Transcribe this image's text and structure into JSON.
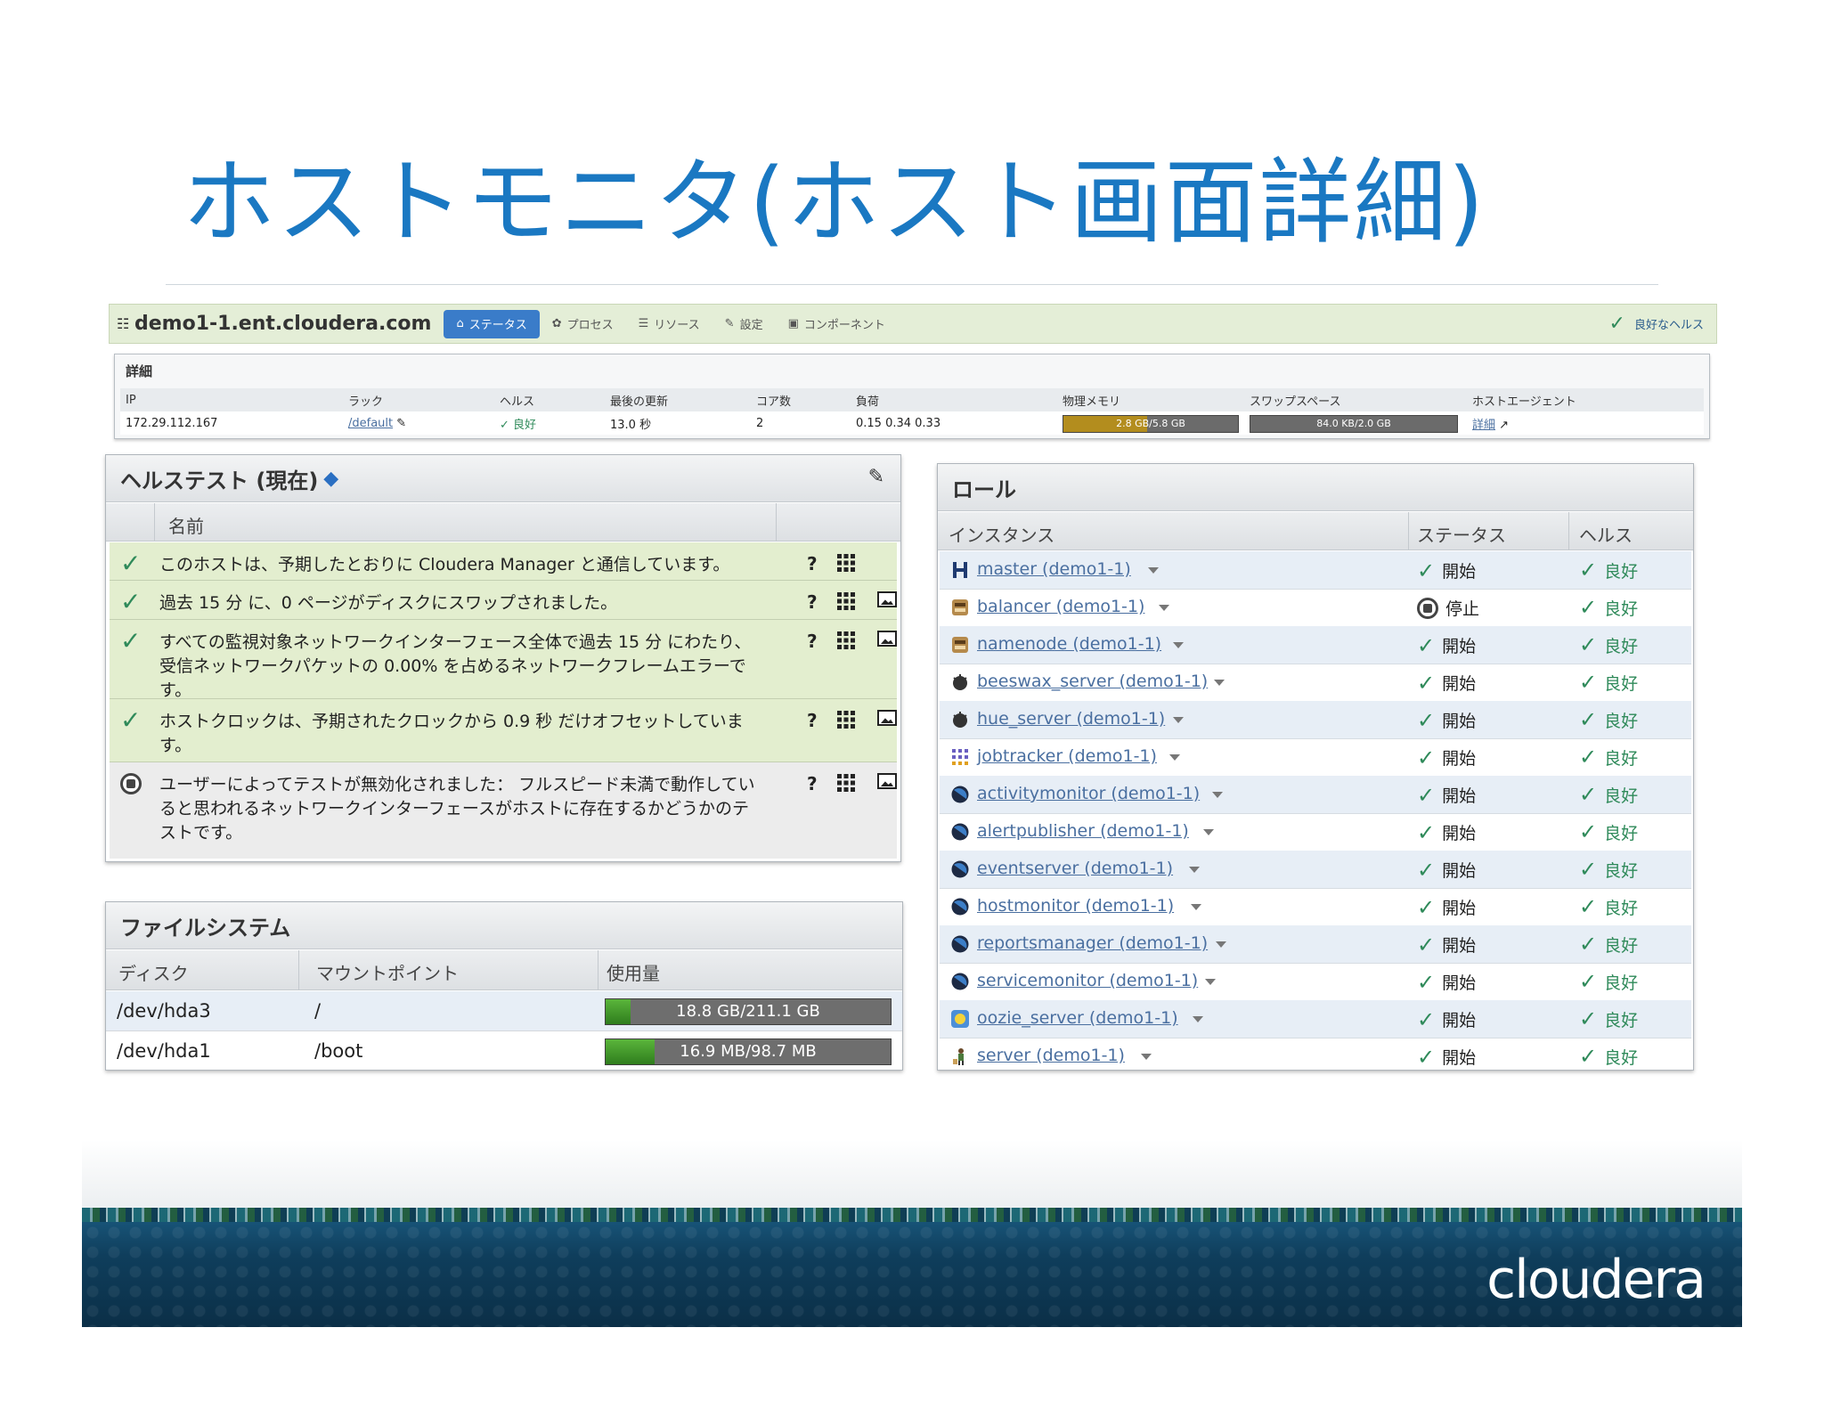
{
  "slide": {
    "title": "ホストモニタ(ホスト画面詳細)"
  },
  "hostbar": {
    "host_name": "demo1-1.ent.cloudera.com",
    "tabs": [
      {
        "label": "ステータス",
        "icon": "home-icon",
        "active": true
      },
      {
        "label": "プロセス",
        "icon": "gear-icon",
        "active": false
      },
      {
        "label": "リソース",
        "icon": "list-icon",
        "active": false
      },
      {
        "label": "設定",
        "icon": "edit-icon",
        "active": false
      },
      {
        "label": "コンポーネント",
        "icon": "gift-icon",
        "active": false
      }
    ],
    "health_label": "良好なヘルス"
  },
  "details": {
    "title": "詳細",
    "headers": [
      "IP",
      "ラック",
      "ヘルス",
      "最後の更新",
      "コア数",
      "負荷",
      "物理メモリ",
      "スワップスペース",
      "ホストエージェント"
    ],
    "ip": "172.29.112.167",
    "rack": "/default",
    "health": "良好",
    "last_update": "13.0 秒",
    "cores": "2",
    "load": "0.15 0.34 0.33",
    "memory": {
      "label": "2.8 GB/5.8 GB",
      "fraction": 0.48,
      "color": "#b38d1e"
    },
    "swap": {
      "label": "84.0 KB/2.0 GB",
      "fraction": 0.0,
      "color": "#6b6b6b"
    },
    "agent_link": "詳細"
  },
  "health_tests": {
    "title": "ヘルステスト (現在)",
    "column_name": "名前",
    "rows": [
      {
        "status": "good",
        "text": "このホストは、予期したとおりに Cloudera Manager と通信しています。",
        "has_image": false
      },
      {
        "status": "good",
        "text": "過去 15 分 に、0 ページがディスクにスワップされました。",
        "has_image": true
      },
      {
        "status": "good",
        "text": "すべての監視対象ネットワークインターフェース全体で過去 15 分 にわたり、受信ネットワークパケットの 0.00% を占めるネットワークフレームエラーです。",
        "has_image": true
      },
      {
        "status": "good",
        "text": "ホストクロックは、予期されたクロックから 0.9 秒 だけオフセットしています。",
        "has_image": true
      },
      {
        "status": "disabled",
        "text": "ユーザーによってテストが無効化されました： フルスピード未満で動作していると思われるネットワークインターフェースがホストに存在するかどうかのテストです。",
        "has_image": true
      }
    ],
    "help_label": "?"
  },
  "filesystem": {
    "title": "ファイルシステム",
    "headers": [
      "ディスク",
      "マウントポイント",
      "使用量"
    ],
    "rows": [
      {
        "disk": "/dev/hda3",
        "mount": "/",
        "usage": "18.8 GB/211.1 GB",
        "fraction": 0.089
      },
      {
        "disk": "/dev/hda1",
        "mount": "/boot",
        "usage": "16.9 MB/98.7 MB",
        "fraction": 0.171
      }
    ]
  },
  "roles": {
    "title": "ロール",
    "headers": [
      "インスタンス",
      "ステータス",
      "ヘルス"
    ],
    "rows": [
      {
        "name": "master (demo1-1)",
        "icon": "hbase-icon",
        "status": "開始",
        "status_kind": "started",
        "health": "良好"
      },
      {
        "name": "balancer (demo1-1)",
        "icon": "hdfs-icon",
        "status": "停止",
        "status_kind": "stopped",
        "health": "良好"
      },
      {
        "name": "namenode (demo1-1)",
        "icon": "hdfs-icon",
        "status": "開始",
        "status_kind": "started",
        "health": "良好"
      },
      {
        "name": "beeswax_server (demo1-1)",
        "icon": "hue-icon",
        "status": "開始",
        "status_kind": "started",
        "health": "良好"
      },
      {
        "name": "hue_server (demo1-1)",
        "icon": "hue-icon",
        "status": "開始",
        "status_kind": "started",
        "health": "良好"
      },
      {
        "name": "jobtracker (demo1-1)",
        "icon": "mapreduce-icon",
        "status": "開始",
        "status_kind": "started",
        "health": "良好"
      },
      {
        "name": "activitymonitor (demo1-1)",
        "icon": "monitor-icon",
        "status": "開始",
        "status_kind": "started",
        "health": "良好"
      },
      {
        "name": "alertpublisher (demo1-1)",
        "icon": "monitor-icon",
        "status": "開始",
        "status_kind": "started",
        "health": "良好"
      },
      {
        "name": "eventserver (demo1-1)",
        "icon": "monitor-icon",
        "status": "開始",
        "status_kind": "started",
        "health": "良好"
      },
      {
        "name": "hostmonitor (demo1-1)",
        "icon": "monitor-icon",
        "status": "開始",
        "status_kind": "started",
        "health": "良好"
      },
      {
        "name": "reportsmanager (demo1-1)",
        "icon": "monitor-icon",
        "status": "開始",
        "status_kind": "started",
        "health": "良好"
      },
      {
        "name": "servicemonitor (demo1-1)",
        "icon": "monitor-icon",
        "status": "開始",
        "status_kind": "started",
        "health": "良好"
      },
      {
        "name": "oozie_server (demo1-1)",
        "icon": "oozie-icon",
        "status": "開始",
        "status_kind": "started",
        "health": "良好"
      },
      {
        "name": "server (demo1-1)",
        "icon": "zookeeper-icon",
        "status": "開始",
        "status_kind": "started",
        "health": "良好"
      }
    ]
  },
  "footer": {
    "logo_text": "cloudera"
  },
  "colors": {
    "title_blue": "#1a78c2",
    "good_green": "#2f8a5a",
    "link_blue": "#4a6fa0",
    "active_tab": "#3a7cc9"
  }
}
